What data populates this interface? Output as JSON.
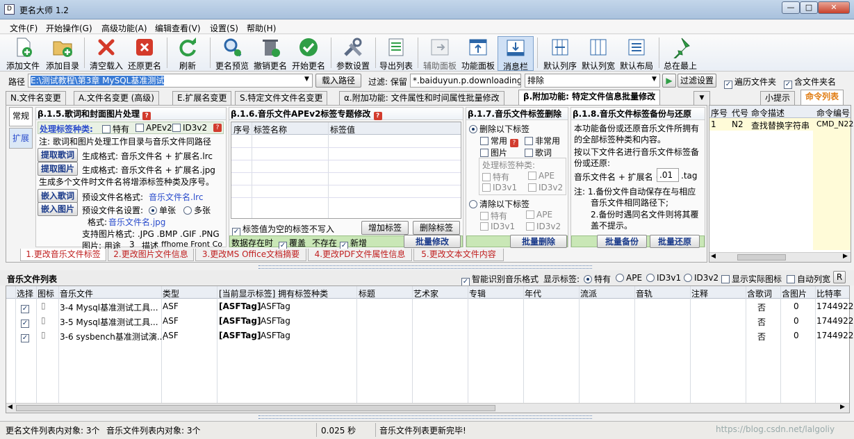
{
  "window": {
    "title": "更名大师 1.2",
    "icon_glyph": "D"
  },
  "menu": [
    "文件(F)",
    "开始操作(G)",
    "高级功能(A)",
    "编辑查看(V)",
    "设置(S)",
    "帮助(H)"
  ],
  "toolbar": [
    {
      "label": "添加文件",
      "icon": "add-file-icon",
      "color": "#2f9e46"
    },
    {
      "label": "添加目录",
      "icon": "add-folder-icon",
      "color": "#c79a2c"
    },
    {
      "label": "清空载入",
      "icon": "clear-icon",
      "color": "#d43a2a"
    },
    {
      "label": "还原更名",
      "icon": "undo-rename-icon",
      "color": "#d43a2a"
    },
    {
      "label": "刷新",
      "icon": "refresh-icon",
      "color": "#2f9e46"
    },
    {
      "label": "更名预览",
      "icon": "preview-icon",
      "color": "#2b66a8"
    },
    {
      "label": "撤销更名",
      "icon": "undo-icon",
      "color": "#555a66"
    },
    {
      "label": "开始更名",
      "icon": "start-icon",
      "color": "#2f9e46"
    },
    {
      "label": "参数设置",
      "icon": "settings-icon",
      "color": "#5b6b85"
    },
    {
      "label": "导出列表",
      "icon": "export-icon",
      "color": "#2f9e46"
    },
    {
      "label": "辅助面板",
      "icon": "aux-panel-icon",
      "color": "#9aa3ad"
    },
    {
      "label": "功能面板",
      "icon": "function-panel-icon",
      "color": "#2b66a8"
    },
    {
      "label": "消息栏",
      "icon": "message-bar-icon",
      "color": "#2b66a8"
    },
    {
      "label": "默认列序",
      "icon": "column-order-icon",
      "color": "#2b66a8"
    },
    {
      "label": "默认列宽",
      "icon": "column-width-icon",
      "color": "#2b66a8"
    },
    {
      "label": "默认布局",
      "icon": "layout-icon",
      "color": "#2b66a8"
    },
    {
      "label": "总在最上",
      "icon": "pin-icon",
      "color": "#2f9e46"
    }
  ],
  "pathbar": {
    "path_label": "路径",
    "path_value": "E:\\测试教程\\第3章 MySQL基准测试",
    "load_btn": "载入路径",
    "filter_label": "过滤: 保留",
    "filter_value": "*.baiduyun.p.downloading",
    "exclude_value": "排除",
    "filter_btn": "过滤设置",
    "recurse": "遍历文件夹",
    "include_folder": "含文件夹名"
  },
  "main_tabs": [
    "N.文件名变更",
    "A.文件名变更 (高级)",
    "E.扩展名变更",
    "S.特定文件文件名变更",
    "α.附加功能: 文件属性和时间属性批量修改",
    "β.附加功能: 特定文件信息批量修改"
  ],
  "right_tabs": [
    "小提示",
    "命令列表"
  ],
  "side_tabs": [
    "常规",
    "扩展"
  ],
  "s15": {
    "title": "β.1.5.歌词和封面图片处理",
    "kind_label": "处理标签种类:",
    "kinds": [
      "特有",
      "APEv2",
      "ID3v2"
    ],
    "note": "注: 歌词和图片处理工作目录与音乐文件同路径",
    "extract_lyrics": "提取歌词",
    "extract_lyrics_fmt": "生成格式: 音乐文件名 + 扩展名.lrc",
    "extract_pic": "提取图片",
    "extract_pic_fmt": "生成格式: 音乐文件名 + 扩展名.jpg",
    "multi_note": "生成多个文件时文件名将增添标签种类及序号。",
    "embed_lyrics": "嵌入歌词",
    "embed_lyrics_label": "预设文件名格式:",
    "embed_lyrics_value": "音乐文件名.lrc",
    "embed_pic": "嵌入图片",
    "embed_pic_label": "预设文件名设置:",
    "single": "单张",
    "multi": "多张",
    "format_label": "格式:",
    "format_value": "音乐文件名.jpg",
    "support": "支持图片格式: .JPG .BMP .GIF .PNG",
    "pic_label": "图片: 用途",
    "pic_use": "3",
    "desc_label": "描述",
    "desc_value": "ffhome Front Co"
  },
  "s16": {
    "title": "β.1.6.音乐文件APEv2标签专题修改",
    "cols": [
      "序号",
      "标签名称",
      "标签值"
    ],
    "no_write": "标签值为空的标签不写入",
    "add": "增加标签",
    "del": "删除标签",
    "exists": "数据存在时",
    "overwrite": "覆盖",
    "not_exists": "不存在",
    "new": "新增",
    "batch": "批量修改"
  },
  "s17": {
    "title": "β.1.7.音乐文件标签删除",
    "delete_below": "删除以下标签",
    "common": "常用",
    "uncommon": "非常用",
    "picture": "图片",
    "lyrics": "歌词",
    "kinds_label": "处理标签种类:",
    "k1": "特有",
    "k2": "APE",
    "k3": "ID3v1",
    "k4": "ID3v2",
    "clear_below": "清除以下标签",
    "c1": "特有",
    "c2": "APE",
    "c3": "ID3v1",
    "c4": "ID3v2",
    "batch": "批量删除"
  },
  "s18": {
    "title": "β.1.8.音乐文件标签备份与还原",
    "line1": "本功能备份或还原音乐文件所拥有",
    "line2": "的全部标签种类和内容。",
    "line3": "按以下文件名进行音乐文件标签备",
    "line4": "份或还原:",
    "fname_label": "音乐文件名 + 扩展名 +",
    "fname_value": ".01",
    "fname_ext": ".tag",
    "note1": "注: 1.备份文件自动保存在与相应",
    "note1b": "音乐文件相同路径下;",
    "note2": "2.备份时遇同名文件则将其覆",
    "note2b": "盖不提示。",
    "backup": "批量备份",
    "restore": "批量还原"
  },
  "cmd_list": {
    "cols": [
      "序号",
      "代号",
      "命令描述",
      "命令编号"
    ],
    "rows": [
      [
        "1",
        "N2",
        "查找替换字符串",
        "CMD_N22"
      ]
    ]
  },
  "sub_tabs": [
    "1.更改音乐文件标签",
    "2.更改图片文件信息",
    "3.更改MS Office文档摘要",
    "4.更改PDF文件属性信息",
    "5.更改文本文件内容"
  ],
  "list": {
    "title": "音乐文件列表",
    "smart": "智能识别音乐格式",
    "show_tag": "显示标签:",
    "t1": "特有",
    "t2": "APE",
    "t3": "ID3v1",
    "t4": "ID3v2",
    "show_real": "显示实际图标",
    "auto_width": "自动列宽",
    "r_btn": "R",
    "cols": [
      "选择",
      "图标",
      "音乐文件",
      "类型",
      "[当前显示标签] 拥有标签种类",
      "标题",
      "艺术家",
      "专辑",
      "年代",
      "流派",
      "音轨",
      "注释",
      "含歌词",
      "含图片",
      "比特率"
    ],
    "rows": [
      {
        "name": "3-4 Mysql基准测试工具...",
        "type": "ASF",
        "tag": "[ASFTag]",
        "kinds": "ASFTag",
        "lyrics": "否",
        "pics": "0",
        "bitrate": "1744922"
      },
      {
        "name": "3-5 Mysql基准测试工具...",
        "type": "ASF",
        "tag": "[ASFTag]",
        "kinds": "ASFTag",
        "lyrics": "否",
        "pics": "0",
        "bitrate": "1744922"
      },
      {
        "name": "3-6 sysbench基准测试演...",
        "type": "ASF",
        "tag": "[ASFTag]",
        "kinds": "ASFTag",
        "lyrics": "否",
        "pics": "0",
        "bitrate": "1744922"
      }
    ]
  },
  "status": {
    "s1": "更名文件列表内对象: 3个",
    "s2": "音乐文件列表内对象: 3个",
    "s3": "0.025 秒",
    "s4": "音乐文件列表更新完毕!",
    "watermark": "https://blog.csdn.net/lalgoliy"
  }
}
